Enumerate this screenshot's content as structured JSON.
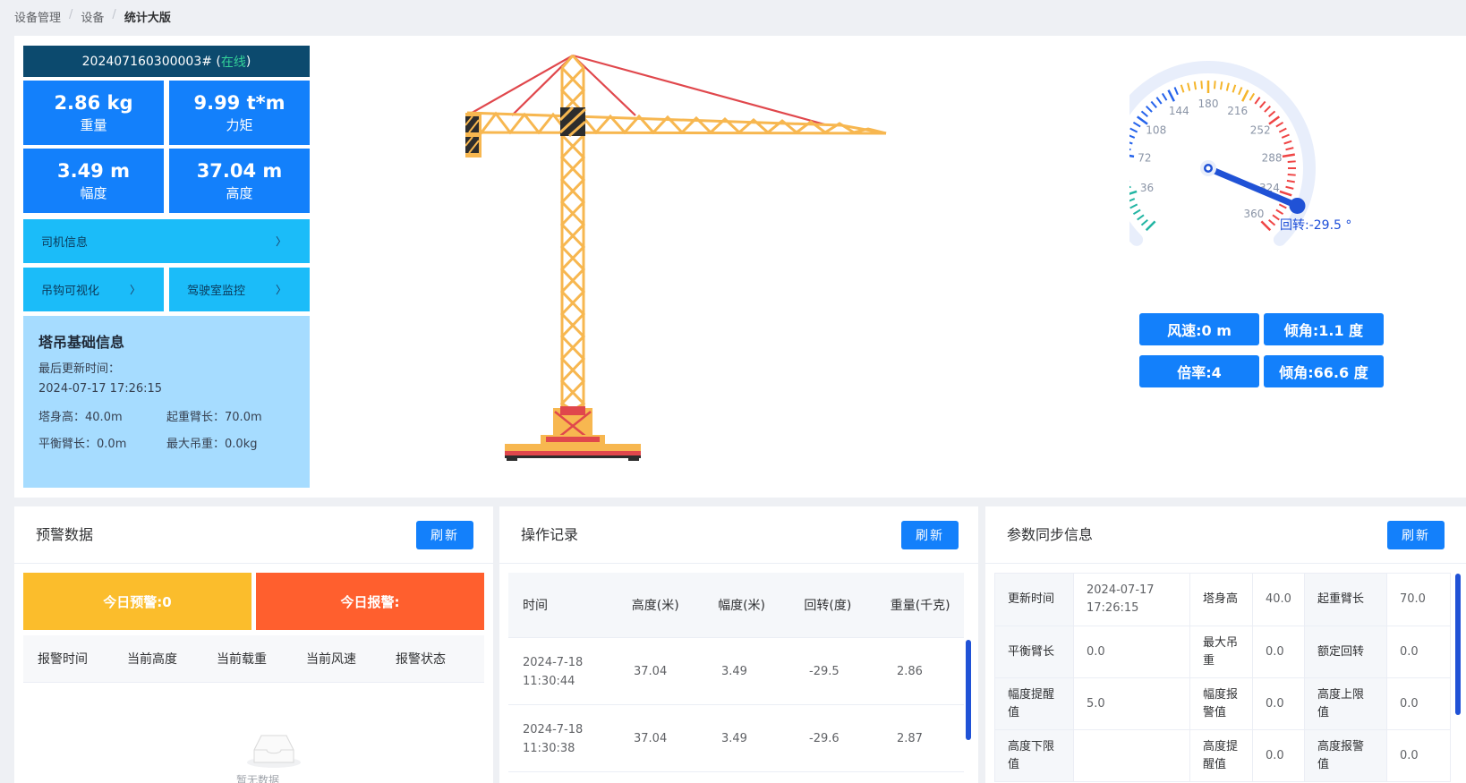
{
  "breadcrumb": [
    "设备管理",
    "设备",
    "统计大版"
  ],
  "device": {
    "id": "202407160300003#",
    "status_prefix": "(",
    "status": "在线",
    "status_suffix": ")"
  },
  "stats": [
    {
      "value": "2.86 kg",
      "label": "重量"
    },
    {
      "value": "9.99 t*m",
      "label": "力矩"
    },
    {
      "value": "3.49 m",
      "label": "幅度"
    },
    {
      "value": "37.04 m",
      "label": "高度"
    }
  ],
  "nav": {
    "driver": "司机信息",
    "hook": "吊钩可视化",
    "cab": "驾驶室监控",
    "chevron": "〉"
  },
  "basic_info": {
    "title": "塔吊基础信息",
    "last_update_label": "最后更新时间：",
    "last_update_value": "2024-07-17 17:26:15",
    "tower_height_label": "塔身高：",
    "tower_height_value": "40.0m",
    "jib_label": "起重臂长：",
    "jib_value": "70.0m",
    "counter_jib_label": "平衡臂长：",
    "counter_jib_value": "0.0m",
    "max_load_label": "最大吊重：",
    "max_load_value": "0.0kg"
  },
  "gauge": {
    "ticks": [
      "36",
      "72",
      "108",
      "144",
      "180",
      "216",
      "252",
      "288",
      "324",
      "360"
    ],
    "reading_label": "回转:-29.5 °",
    "value": -29.5,
    "colors": {
      "low": "#22b5a3",
      "mid": "#2563eb",
      "high_warn": "#f5b52b",
      "high": "#ef4444"
    }
  },
  "metrics": {
    "wind": "风速:0 m",
    "tilt1": "倾角:1.1 度",
    "ratio": "倍率:4",
    "tilt2": "倾角:66.6 度"
  },
  "alerts": {
    "title": "预警数据",
    "refresh": "刷新",
    "warning_today": "今日预警:0",
    "alarm_today": "今日报警:",
    "columns": [
      "报警时间",
      "当前高度",
      "当前载重",
      "当前风速",
      "报警状态"
    ],
    "empty_text": "暂无数据"
  },
  "operations": {
    "title": "操作记录",
    "refresh": "刷新",
    "columns": [
      "时间",
      "高度(米)",
      "幅度(米)",
      "回转(度)",
      "重量(千克)"
    ],
    "rows": [
      {
        "time_date": "2024-7-18",
        "time_clock": "11:30:44",
        "height": "37.04",
        "range": "3.49",
        "rotation": "-29.5",
        "weight": "2.86"
      },
      {
        "time_date": "2024-7-18",
        "time_clock": "11:30:38",
        "height": "37.04",
        "range": "3.49",
        "rotation": "-29.6",
        "weight": "2.87"
      }
    ]
  },
  "params": {
    "title": "参数同步信息",
    "refresh": "刷新",
    "rows": [
      [
        [
          "更新时间",
          ""
        ],
        [
          "2024-07-17",
          "17:26:15"
        ],
        [
          "塔身高",
          ""
        ],
        [
          "40.0",
          ""
        ],
        [
          "起重臂长",
          ""
        ],
        [
          "70.0",
          ""
        ]
      ],
      [
        [
          "平衡臂长",
          ""
        ],
        [
          "0.0",
          ""
        ],
        [
          "最大吊",
          "重"
        ],
        [
          "0.0",
          ""
        ],
        [
          "额定回转",
          ""
        ],
        [
          "0.0",
          ""
        ]
      ],
      [
        [
          "幅度提醒",
          "值"
        ],
        [
          "5.0",
          ""
        ],
        [
          "幅度报",
          "警值"
        ],
        [
          "0.0",
          ""
        ],
        [
          "高度上限",
          "值"
        ],
        [
          "0.0",
          ""
        ]
      ],
      [
        [
          "高度下限",
          "值"
        ],
        [
          "",
          ""
        ],
        [
          "高度提",
          "醒值"
        ],
        [
          "0.0",
          ""
        ],
        [
          "高度报警",
          "值"
        ],
        [
          "0.0",
          ""
        ]
      ]
    ]
  }
}
